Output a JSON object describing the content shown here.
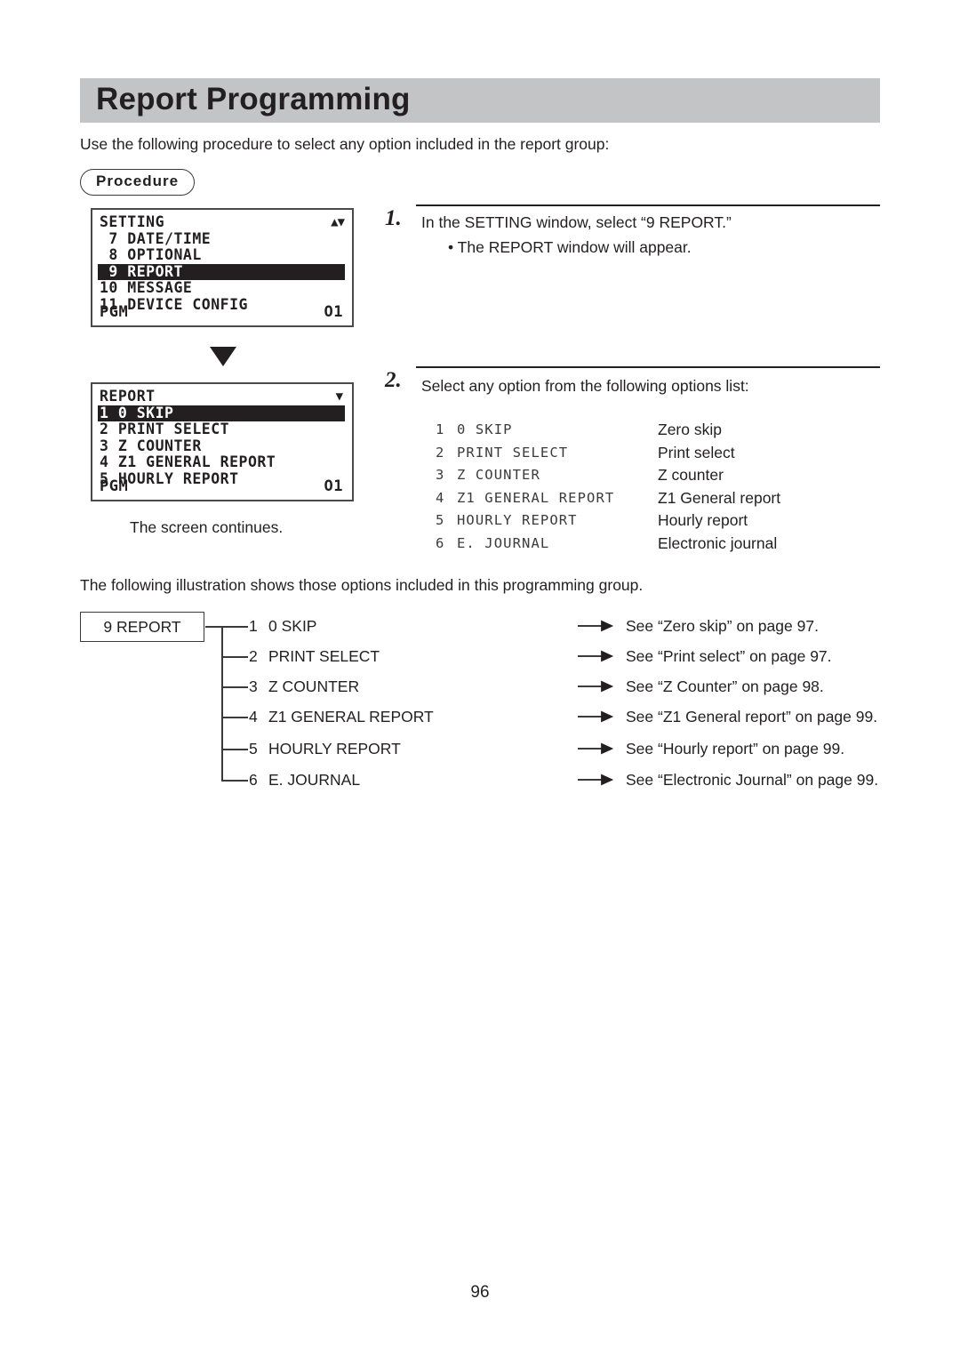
{
  "header": {
    "title": "Report Programming"
  },
  "intro": "Use the following procedure to select any option included in the report group:",
  "procedure_badge": "Procedure",
  "lcd_setting": {
    "title": "SETTING",
    "arrows": "▲▼",
    "rows": [
      {
        "text": " 7 DATE/TIME",
        "selected": false
      },
      {
        "text": " 8 OPTIONAL",
        "selected": false
      },
      {
        "text": " 9 REPORT",
        "selected": true
      },
      {
        "text": "10 MESSAGE",
        "selected": false
      },
      {
        "text": "11 DEVICE CONFIG",
        "selected": false
      }
    ],
    "status_left": "PGM",
    "status_right": "O1"
  },
  "lcd_report": {
    "title": "REPORT",
    "arrows": "▼",
    "rows": [
      {
        "text": "1 0 SKIP",
        "selected": true
      },
      {
        "text": "2 PRINT SELECT",
        "selected": false
      },
      {
        "text": "3 Z COUNTER",
        "selected": false
      },
      {
        "text": "4 Z1 GENERAL REPORT",
        "selected": false
      },
      {
        "text": "5 HOURLY REPORT",
        "selected": false
      }
    ],
    "status_left": "PGM",
    "status_right": "O1"
  },
  "screen_continues": "The screen continues.",
  "flow_arrow_icon": "down-triangle",
  "step1": {
    "number": "1.",
    "body": "In the SETTING window, select “9 REPORT.”",
    "sub": "• The REPORT window will appear."
  },
  "step2": {
    "number": "2.",
    "body": "Select any option from the following options list:",
    "options": [
      {
        "index": "1",
        "code": "0 SKIP",
        "desc": "Zero skip"
      },
      {
        "index": "2",
        "code": "PRINT SELECT",
        "desc": "Print select"
      },
      {
        "index": "3",
        "code": "Z COUNTER",
        "desc": "Z counter"
      },
      {
        "index": "4",
        "code": "Z1 GENERAL REPORT",
        "desc": "Z1 General report"
      },
      {
        "index": "5",
        "code": "HOURLY REPORT",
        "desc": "Hourly report"
      },
      {
        "index": "6",
        "code": "E. JOURNAL",
        "desc": "Electronic journal"
      }
    ]
  },
  "illustration_note": "The following illustration shows those options included in this programming group.",
  "tree": {
    "root": "9 REPORT",
    "items": [
      {
        "num": "1",
        "label": "0 SKIP",
        "ref": "See “Zero skip” on page 97."
      },
      {
        "num": "2",
        "label": "PRINT SELECT",
        "ref": "See “Print select” on page 97."
      },
      {
        "num": "3",
        "label": "Z COUNTER",
        "ref": "See “Z Counter” on page 98."
      },
      {
        "num": "4",
        "label": "Z1 GENERAL REPORT",
        "ref": "See “Z1 General report” on page 99."
      },
      {
        "num": "5",
        "label": "HOURLY REPORT",
        "ref": "See “Hourly report” on page 99."
      },
      {
        "num": "6",
        "label": "E. JOURNAL",
        "ref": "See “Electronic Journal” on page 99."
      }
    ]
  },
  "page_number": "96",
  "colors": {
    "header_band": "#c3c4c6",
    "ink": "#231f20",
    "rule": "#3a3a3a"
  }
}
